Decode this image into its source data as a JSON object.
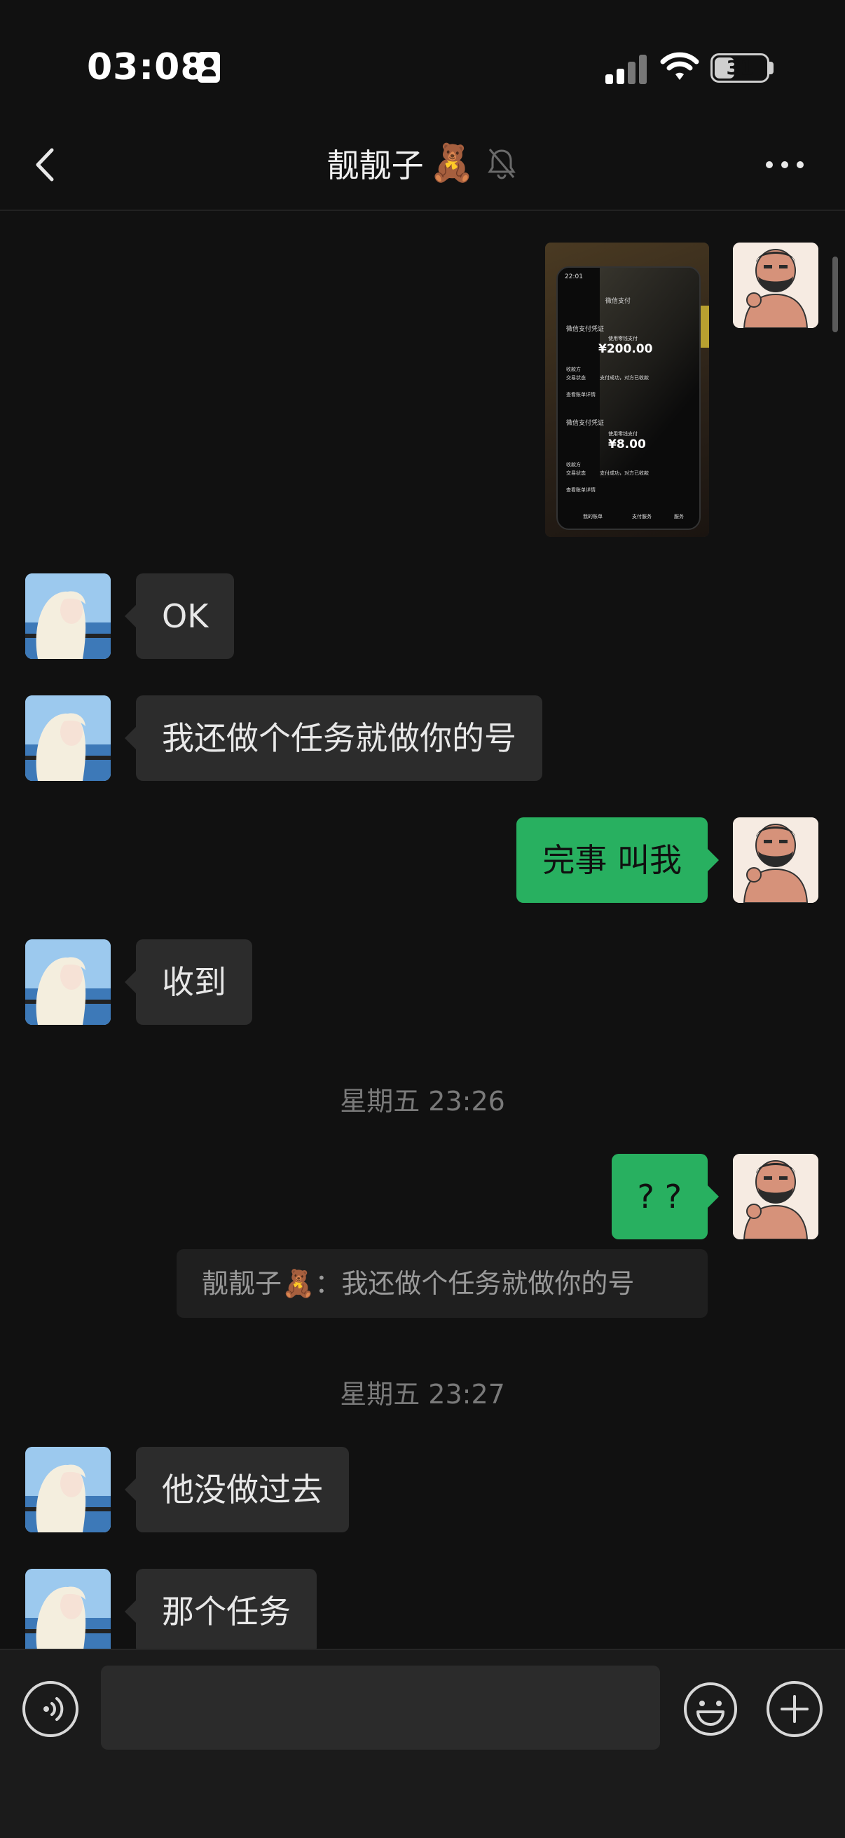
{
  "status_bar": {
    "time": "03:08",
    "battery": "31"
  },
  "header": {
    "title": "靓靓子",
    "title_emoji": "🧸"
  },
  "photo_message": {
    "screen_title": "微信支付",
    "header_time": "22:01",
    "section_label": "微信支付凭证",
    "pay_label": "使用零钱支付",
    "amount_1": "¥200.00",
    "amount_2": "¥8.00",
    "row_label": "收款方",
    "row_label_2": "交易状态",
    "row_value": "支付成功，对方已收款",
    "bill_link": "查看账单详情",
    "tab_1": "我的账单",
    "tab_2": "支付服务",
    "tab_3": "服务"
  },
  "messages": {
    "m1": "OK",
    "m2": "我还做个任务就做你的号",
    "m3": "完事 叫我",
    "m4": "收到",
    "ts1": "星期五 23:26",
    "m5": "? ?",
    "quote_name": "靓靓子",
    "quote_emoji": "🧸",
    "quote_sep": "：",
    "quote_text": "我还做个任务就做你的号",
    "ts2": "星期五 23:27",
    "m6": "他没做过去",
    "m7": "那个任务"
  },
  "input": {
    "placeholder": ""
  },
  "colors": {
    "outgoing_bubble": "#28b060",
    "incoming_bubble": "#2c2c2c",
    "background": "#111111"
  }
}
